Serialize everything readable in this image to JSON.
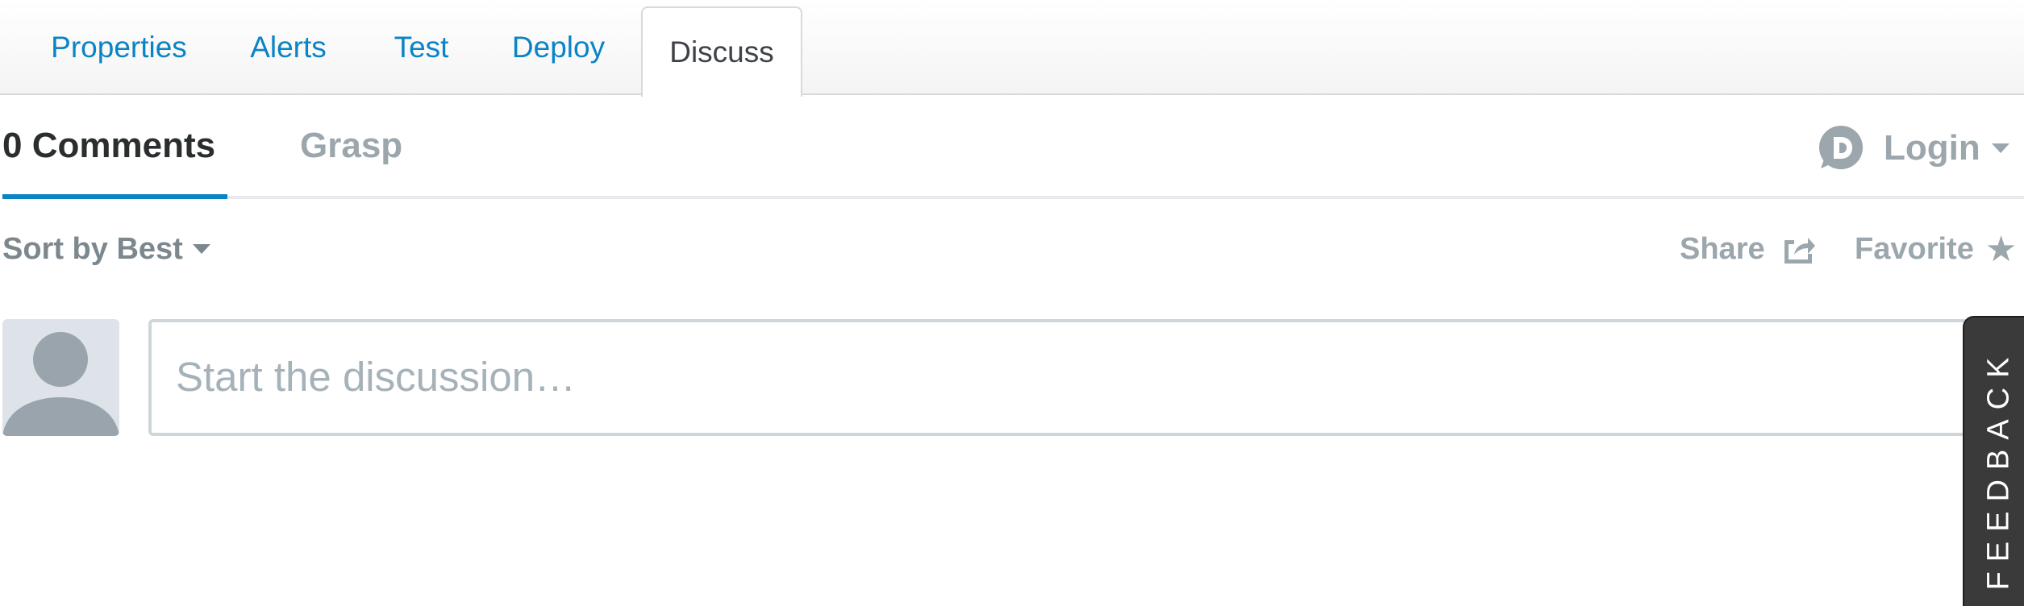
{
  "tabs": [
    {
      "label": "Properties"
    },
    {
      "label": "Alerts"
    },
    {
      "label": "Test"
    },
    {
      "label": "Deploy"
    },
    {
      "label": "Discuss",
      "active": true
    }
  ],
  "disqus": {
    "comments_tab": "0 Comments",
    "community_tab": "Grasp",
    "login_label": "Login",
    "sort_label": "Sort by Best",
    "share_label": "Share",
    "favorite_label": "Favorite",
    "composer_placeholder": "Start the discussion…"
  },
  "feedback": {
    "label": "FEEDBACK"
  },
  "icons": {
    "disqus_logo": "disqus-logo-icon",
    "share": "share-icon",
    "favorite": "star-icon",
    "avatar": "user-avatar-icon"
  },
  "colors": {
    "link": "#0a84c6",
    "active_underline": "#0a84c6",
    "muted": "#9ba6ad",
    "feedback_bg": "#3a3a3a"
  }
}
